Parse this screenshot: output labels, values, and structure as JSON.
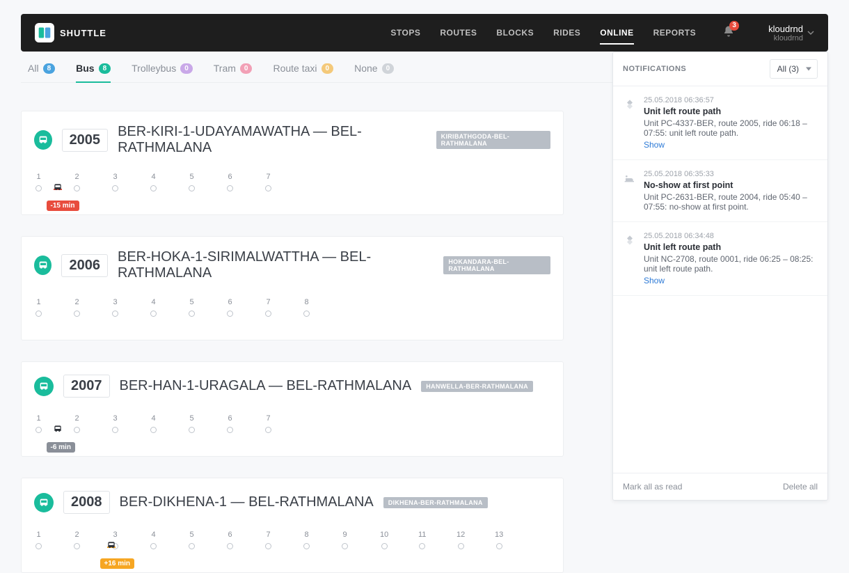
{
  "brand": "SHUTTLE",
  "nav": [
    "STOPS",
    "ROUTES",
    "BLOCKS",
    "RIDES",
    "ONLINE",
    "REPORTS"
  ],
  "nav_active": 4,
  "bell_count": "3",
  "user": {
    "name": "kloudrnd",
    "sub": "kloudrnd"
  },
  "tabs": [
    {
      "label": "All",
      "count": "8",
      "color": "blue"
    },
    {
      "label": "Bus",
      "count": "8",
      "color": "green",
      "active": true
    },
    {
      "label": "Trolleybus",
      "count": "0",
      "color": "purple"
    },
    {
      "label": "Tram",
      "count": "0",
      "color": "pink"
    },
    {
      "label": "Route taxi",
      "count": "0",
      "color": "orange"
    },
    {
      "label": "None",
      "count": "0",
      "color": "grey"
    }
  ],
  "routes": [
    {
      "num": "2005",
      "name": "BER-KIRI-1-UDAYAMAWATHA — BEL-RATHMALANA",
      "tag": "KIRIBATHGODA-BEL-RATHMALANA",
      "stops": 7,
      "spacing": 55,
      "bus_at": 1.5,
      "delay": "-15 min",
      "delay_color": "red"
    },
    {
      "num": "2006",
      "name": "BER-HOKA-1-SIRIMALWATTHA — BEL-RATHMALANA",
      "tag": "HOKANDARA-BEL-RATHMALANA",
      "stops": 8,
      "spacing": 55
    },
    {
      "num": "2007",
      "name": "BER-HAN-1-URAGALA — BEL-RATHMALANA",
      "tag": "HANWELLA-BER-RATHMALANA",
      "stops": 7,
      "spacing": 55,
      "bus_at": 1.5,
      "delay": "-6 min",
      "delay_color": "grey"
    },
    {
      "num": "2008",
      "name": "BER-DIKHENA-1 — BEL-RATHMALANA",
      "tag": "DIKHENA-BER-RATHMALANA",
      "stops": 13,
      "spacing": 55,
      "bus_at": 2.9,
      "delay": "+16 min",
      "delay_color": "orange"
    }
  ],
  "notifications": {
    "title": "NOTIFICATIONS",
    "filter": "All (3)",
    "mark_all": "Mark all as read",
    "delete_all": "Delete all",
    "items": [
      {
        "time": "25.05.2018 06:36:57",
        "head": "Unit left route path",
        "body": "Unit PC-4337-BER, route 2005, ride 06:18 – 07:55: unit left route path.",
        "show": "Show",
        "icon": "diamond"
      },
      {
        "time": "25.05.2018 06:35:33",
        "head": "No-show at first point",
        "body": "Unit PC-2631-BER, route 2004, ride 05:40 – 07:55: no-show at first point.",
        "icon": "bed"
      },
      {
        "time": "25.05.2018 06:34:48",
        "head": "Unit left route path",
        "body": "Unit NC-2708, route 0001, ride 06:25 – 08:25: unit left route path.",
        "show": "Show",
        "icon": "diamond"
      }
    ]
  }
}
